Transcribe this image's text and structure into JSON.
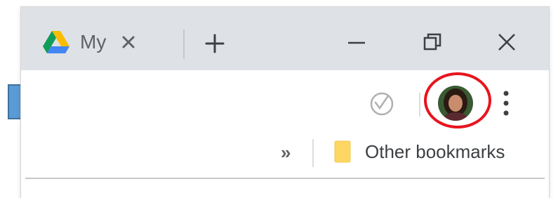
{
  "tab": {
    "title": "My Drive - Google Drive",
    "close_icon": "close-icon",
    "favicon": "google-drive-icon"
  },
  "new_tab_icon": "plus-icon",
  "window_controls": {
    "minimize_icon": "minimize-icon",
    "restore_icon": "restore-icon",
    "close_icon": "close-icon"
  },
  "toolbar": {
    "extension_icon": "extension-check-icon",
    "profile_icon": "profile-avatar",
    "menu_icon": "vertical-dots-icon"
  },
  "bookmarks": {
    "more_chevron": "»",
    "other_bookmarks_label": "Other bookmarks",
    "folder_icon": "folder-icon"
  },
  "annotations": {
    "arrow_color": "#5b9bd5",
    "arrow_border": "#41719c",
    "circle_color": "#e8141d"
  }
}
